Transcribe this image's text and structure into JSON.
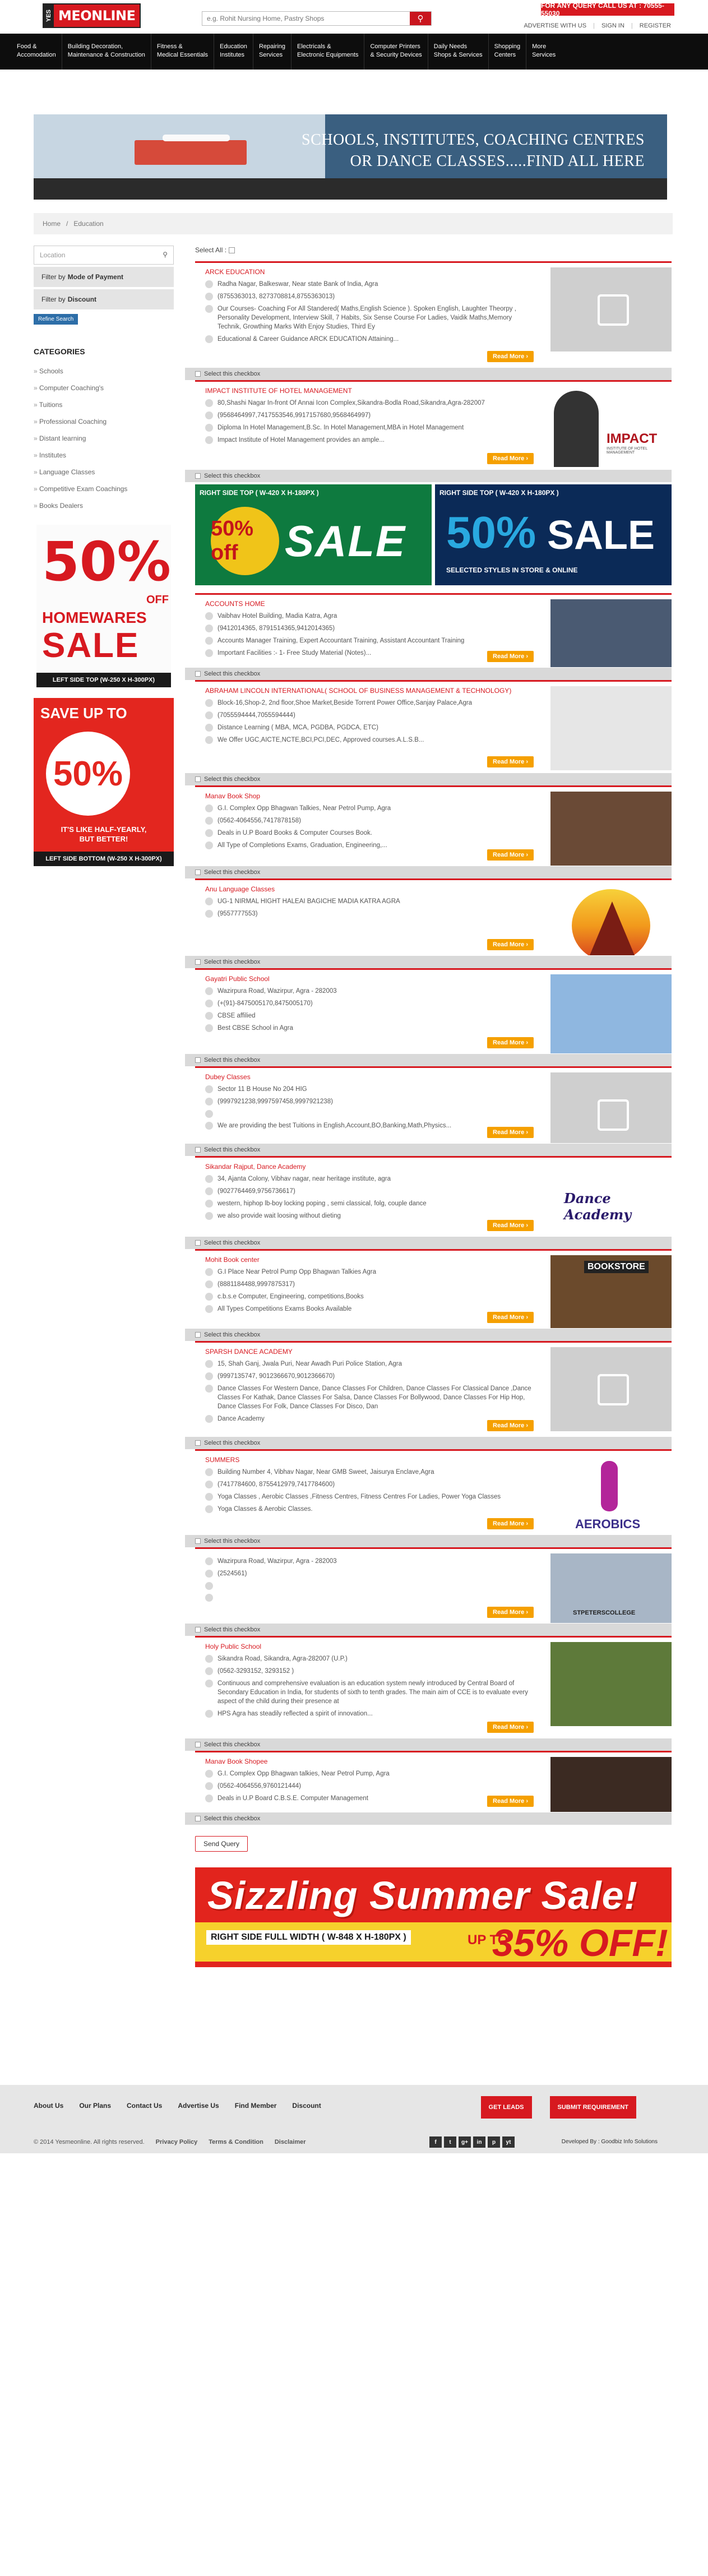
{
  "header": {
    "logo_yes": "YES",
    "logo_me": "MEONLINE",
    "search_placeholder": "e.g. Rohit Nursing Home, Pastry Shops",
    "query_text": "FOR ANY QUERY CALL US AT : 70555-55030",
    "advertise": "ADVERTISE WITH US",
    "signin": "SIGN IN",
    "register": "REGISTER",
    "sep": "|"
  },
  "nav": [
    [
      "Food &",
      "Accomodation"
    ],
    [
      "Building Decoration,",
      "Maintenance & Construction"
    ],
    [
      "Fitness &",
      "Medical Essentials"
    ],
    [
      "Education",
      "Institutes"
    ],
    [
      "Repairing",
      "Services"
    ],
    [
      "Electricals &",
      "Electronic Equipments"
    ],
    [
      "Computer Printers",
      "& Security Devices"
    ],
    [
      "Daily Needs",
      "Shops & Services"
    ],
    [
      "Shopping",
      "Centers"
    ],
    [
      "More",
      "Services"
    ]
  ],
  "banner": {
    "line1": "SCHOOLS, INSTITUTES, COACHING CENTRES",
    "line2": "OR DANCE CLASSES.....FIND ALL HERE"
  },
  "breadcrumb": {
    "home": "Home",
    "sep": "/",
    "current": "Education"
  },
  "sidebar": {
    "location_placeholder": "Location",
    "filter_payment_prefix": "Filter by",
    "filter_payment": "Mode of Payment",
    "filter_discount_prefix": "Filter by",
    "filter_discount": "Discount",
    "refine": "Refine Search",
    "categories_title": "CATEGORIES",
    "categories": [
      "Schools",
      "Computer Coaching's",
      "Tuitions",
      "Professional Coaching",
      "Distant learning",
      "Institutes",
      "Language Classes",
      "Competitive Exam Coachings",
      "Books Dealers"
    ],
    "ad1": {
      "big": "50%",
      "off": "OFF",
      "line1": "HOMEWARES",
      "sale": "SALE",
      "label": "LEFT SIDE TOP (W-250 X H-300PX)"
    },
    "ad2": {
      "up": "SAVE UP TO",
      "pct": "50%",
      "hy1": "IT'S LIKE HALF-YEARLY,",
      "hy2": "BUT BETTER!",
      "label": "LEFT SIDE BOTTOM (W-250 X H-300PX)"
    }
  },
  "select_all": "Select All :",
  "select_checkbox": "Select this checkbox",
  "read_more": "Read More ›",
  "listings": [
    {
      "name": "ARCK EDUCATION",
      "rows": [
        "Radha Nagar, Balkeswar, Near state Bank of India, Agra",
        "(8755363013, 8273708814,8755363013)",
        "Our Courses- Coaching For All Standered( Maths,English Science ). Spoken English, Laughter Theorpy , Personality Development, Interview Skill, 7 Habits, Six Sense Course For Ladies, Vaidik Maths,Memory Technik, Growthing Marks With Enjoy Studies, Third Ey",
        "Educational & Career Guidance ARCK EDUCATION Attaining..."
      ],
      "img": "placeholder"
    },
    {
      "name": "IMPACT INSTITUTE OF HOTEL MANAGEMENT",
      "rows": [
        "80,Shashi Nagar In-front Of Annai Icon Complex,Sikandra-Bodla Road,Sikandra,Agra-282007",
        "(9568464997,7417553546,9917157680,9568464997)",
        "Diploma In Hotel Management,B.Sc. In Hotel Management,MBA in Hotel Management",
        "Impact Institute of Hotel Management provides an ample..."
      ],
      "img": "impact",
      "img_text": "IMPACT",
      "img_sub": "INSTITUTE OF HOTEL MANAGEMENT"
    },
    {
      "name": "ACCOUNTS HOME",
      "rows": [
        "Vaibhav Hotel Building, Madia Katra, Agra",
        "(9412014365, 8791514365,9412014365)",
        "Accounts Manager Training, Expert Accountant Training, Assistant Accountant Training",
        "Important Facilities :- 1- Free Study Material (Notes)..."
      ],
      "img": "class"
    },
    {
      "name": "ABRAHAM LINCOLN INTERNATIONAL( SCHOOL OF BUSINESS MANAGEMENT & TECHNOLOGY)",
      "rows": [
        "Block-16,Shop-2, 2nd floor,Shoe Market,Beside Torrent Power Office,Sanjay Palace,Agra",
        "(7055594444,7055594444)",
        "Distance Learning ( MBA, MCA, PGDBA, PGDCA, ETC)",
        "We Offer UGC,AICTE,NCTE,BCI,PCI,DEC, Approved courses.A.L.S.B..."
      ],
      "img": "doc"
    },
    {
      "name": "Manav Book Shop",
      "rows": [
        "G.I. Complex Opp Bhagwan Talkies, Near Petrol Pump, Agra",
        "(0562-4064556,7417878158)",
        "Deals in U.P Board Books & Computer Courses Book.",
        "All Type of Completions Exams, Graduation, Engineering,..."
      ],
      "img": "library"
    },
    {
      "name": "Anu Language Classes",
      "rows": [
        "UG-1 NIRMAL HIGHT HALEAI BAGICHE MADIA KATRA AGRA",
        "(9557777553)"
      ],
      "img": "anu"
    },
    {
      "name": "Gayatri Public School",
      "rows": [
        "Wazirpura Road, Wazirpur, Agra - 282003",
        "(+(91)-8475005170,8475005170)",
        "CBSE affilied",
        "Best CBSE School in Agra"
      ],
      "img": "school"
    },
    {
      "name": "Dubey Classes",
      "rows": [
        "Sector 11 B House No 204 HIG",
        "(9997921238,9997597458,9997921238)",
        "",
        "We are providing the best Tuitions in English,Account,BO,Banking,Math,Physics..."
      ],
      "img": "placeholder"
    },
    {
      "name": "Sikandar Rajput, Dance Academy",
      "rows": [
        "34, Ajanta Colony, Vibhav nagar, near heritage institute, agra",
        "(9027764469,9756736617)",
        "western, hiphop lb-boy locking poping , semi classical, folg, couple dance",
        "we also provide wait loosing without dieting"
      ],
      "img": "dance",
      "img_text": "Dance Academy"
    },
    {
      "name": "Mohit Book center",
      "rows": [
        "G.I Place Near Petrol Pump Opp Bhagwan Talkies Agra",
        "(8881184488,9997875317)",
        "c.b.s.e Computer, Engineering, competitions,Books",
        "All Types Competitions Exams Books Available"
      ],
      "img": "bookstore",
      "img_text": "BOOKSTORE"
    },
    {
      "name": "SPARSH DANCE ACADEMY",
      "rows": [
        "15, Shah Ganj, Jwala Puri, Near Awadh Puri Police Station, Agra",
        "(9997135747, 9012366670,9012366670)",
        "Dance Classes For Western Dance, Dance Classes For Children, Dance Classes For Classical Dance ,Dance Classes For Kathak, Dance Classes For Salsa, Dance Classes For Bollywood, Dance Classes For Hip Hop, Dance Classes For Folk, Dance Classes For Disco, Dan",
        "Dance Academy"
      ],
      "img": "placeholder"
    },
    {
      "name": "SUMMERS",
      "rows": [
        "Building Number 4, Vibhav Nagar, Near GMB Sweet, Jaisurya Enclave,Agra",
        "(7417784600, 8755412979,7417784600)",
        "Yoga Classes , Aerobic Classes ,Fitness Centres, Fitness Centres For Ladies, Power Yoga Classes",
        "Yoga Classes & Aerobic Classes."
      ],
      "img": "aerobics",
      "img_text": "AEROBICS"
    },
    {
      "name": "",
      "rows": [
        "Wazirpura Road, Wazirpur, Agra - 282003",
        "(2524561)",
        "",
        ""
      ],
      "img": "college",
      "img_text": "STPETERSCOLLEGE"
    },
    {
      "name": "Holy Public School",
      "rows": [
        "Sikandra Road, Sikandra, Agra-282007 (U.P.)",
        "(0562-3293152, 3293152 )",
        "Continuous and comprehensive evaluation is an education system newly introduced by Central Board of Secondary Education in India, for students of sixth to tenth grades. The main aim of CCE is to evaluate every aspect of the child during their presence at",
        "HPS Agra has steadily reflected a spirit of innovation..."
      ],
      "img": "holy"
    },
    {
      "name": "Manav Book Shopee",
      "rows": [
        "G.I. Complex Opp Bhagwan talkies, Near Petrol Pump, Agra",
        "(0562-4064556,9760121444)",
        "Deals in U.P Board C.B.S.E. Computer Management"
      ],
      "img": "library2"
    }
  ],
  "mid_ads": {
    "left_label": "RIGHT SIDE TOP ( W-420 X H-180PX )",
    "left_pct": "50% off",
    "left_sale": "SALE",
    "right_label": "RIGHT SIDE TOP ( W-420 X H-180PX )",
    "right_pct": "50%",
    "right_sale": "SALE",
    "right_sub": "SELECTED STYLES IN STORE & ONLINE"
  },
  "send_query": "Send Query",
  "summer_ad": {
    "title": "Sizzling Summer Sale!",
    "label": "RIGHT SIDE FULL WIDTH ( W-848 X H-180PX )",
    "upto": "UP TO",
    "pct": "35% OFF!"
  },
  "footer": {
    "links": [
      "About Us",
      "Our Plans",
      "Contact Us",
      "Advertise Us",
      "Find Member",
      "Discount"
    ],
    "btn_leads": "GET LEADS",
    "btn_req": "SUBMIT REQUIREMENT",
    "copy": "© 2014 Yesmeonline. All rights reserved.",
    "privacy": "Privacy Policy",
    "terms": "Terms & Condition",
    "disclaimer": "Disclaimer",
    "social": [
      "f",
      "t",
      "g+",
      "in",
      "p",
      "yt"
    ],
    "dev": "Developed By : Goodbiz Info Solutions"
  }
}
